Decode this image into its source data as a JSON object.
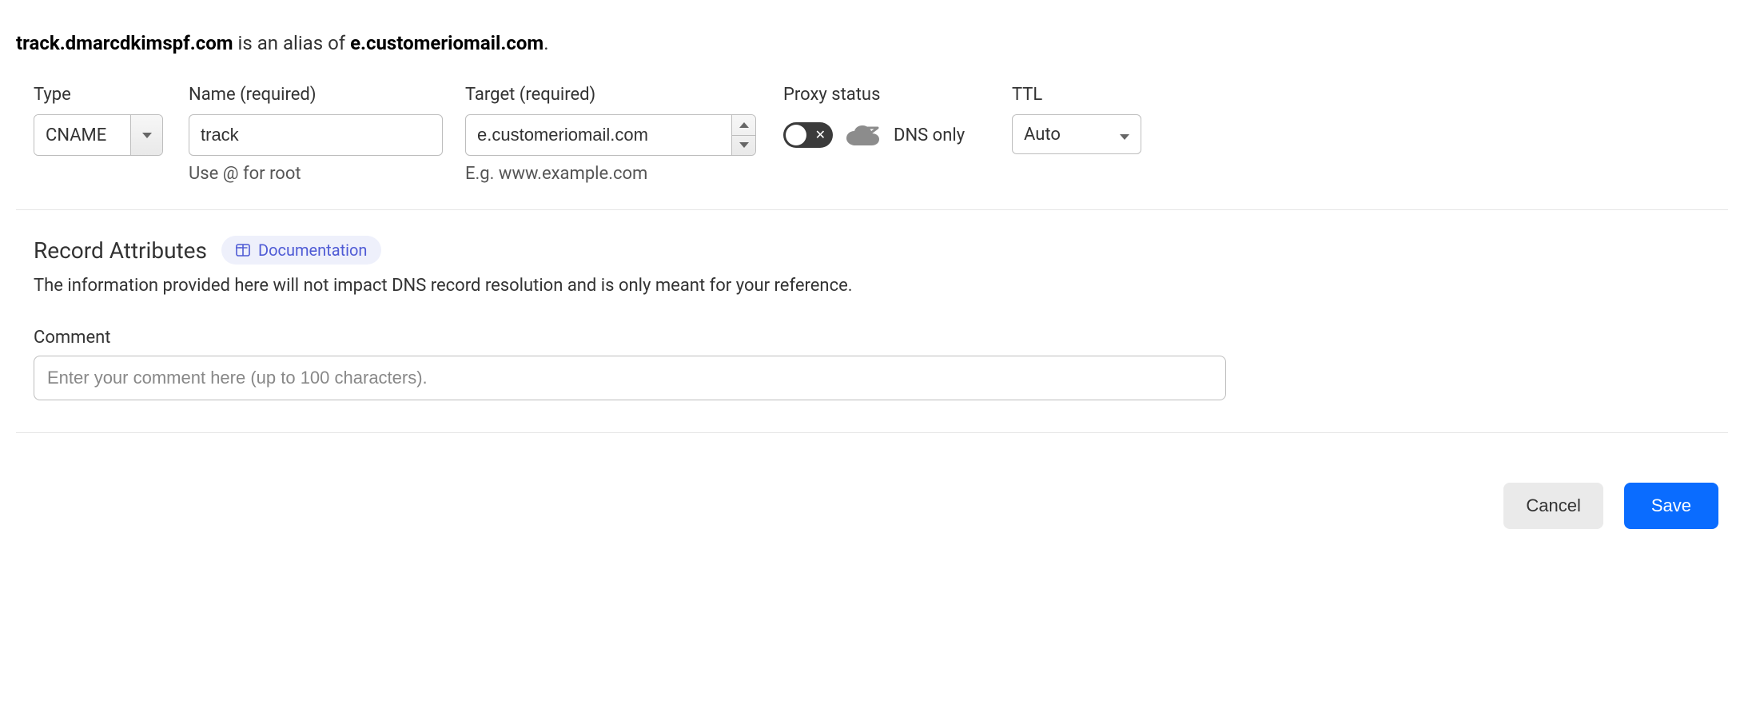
{
  "heading": {
    "host": "track.dmarcdkimspf.com",
    "middle": " is an alias of ",
    "target": "e.customeriomail.com",
    "suffix": "."
  },
  "fields": {
    "type": {
      "label": "Type",
      "value": "CNAME"
    },
    "name": {
      "label": "Name (required)",
      "value": "track",
      "helper": "Use @ for root"
    },
    "target": {
      "label": "Target (required)",
      "value": "e.customeriomail.com",
      "helper": "E.g. www.example.com"
    },
    "proxy": {
      "label": "Proxy status",
      "status_text": "DNS only",
      "enabled": false
    },
    "ttl": {
      "label": "TTL",
      "value": "Auto"
    }
  },
  "attributes": {
    "title": "Record Attributes",
    "doc_label": "Documentation",
    "description": "The information provided here will not impact DNS record resolution and is only meant for your reference.",
    "comment": {
      "label": "Comment",
      "value": "",
      "placeholder": "Enter your comment here (up to 100 characters)."
    }
  },
  "footer": {
    "cancel": "Cancel",
    "save": "Save"
  }
}
